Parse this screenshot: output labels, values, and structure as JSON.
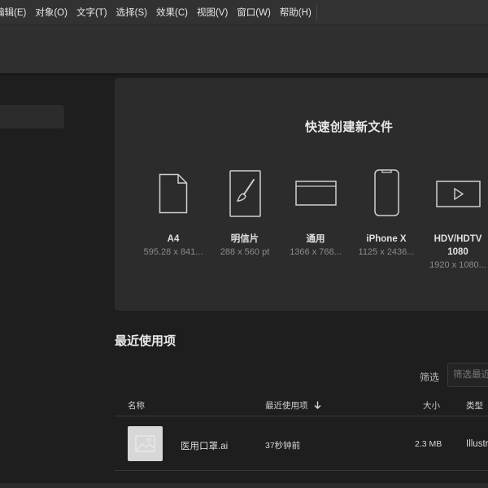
{
  "menu": [
    "编辑(E)",
    "对象(O)",
    "文字(T)",
    "选择(S)",
    "效果(C)",
    "视图(V)",
    "窗口(W)",
    "帮助(H)"
  ],
  "quick_create": {
    "title": "快速创建新文件",
    "presets": [
      {
        "name": "A4",
        "size": "595.28 x 841...",
        "icon": "page-icon"
      },
      {
        "name": "明信片",
        "size": "288 x 560 pt",
        "icon": "postcard-brush-icon"
      },
      {
        "name": "通用",
        "size": "1366 x 768...",
        "icon": "browser-window-icon"
      },
      {
        "name": "iPhone X",
        "size": "1125 x 2436...",
        "icon": "phone-icon"
      },
      {
        "name": "HDV/HDTV",
        "name2": "1080",
        "size": "1920 x 1080...",
        "icon": "video-play-icon"
      }
    ]
  },
  "recent": {
    "title": "最近使用项",
    "filter_label": "筛选",
    "filter_placeholder": "筛选最近",
    "columns": {
      "name": "名称",
      "recent": "最近使用项",
      "size": "大小",
      "type": "类型"
    },
    "rows": [
      {
        "name": "医用口罩.ai",
        "time": "37秒钟前",
        "size": "2.3 MB",
        "type": "Illustr"
      }
    ]
  }
}
